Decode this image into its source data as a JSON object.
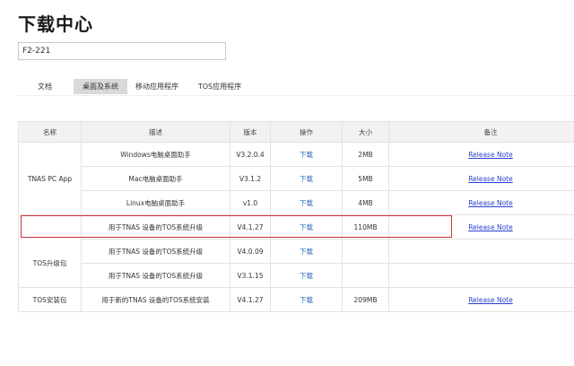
{
  "page": {
    "title": "下载中心"
  },
  "search": {
    "value": "F2-221"
  },
  "tabs": [
    {
      "label": "文档"
    },
    {
      "label": "桌面及系统"
    },
    {
      "label": "移动应用程序"
    },
    {
      "label": "TOS应用程序"
    }
  ],
  "active_tab": "桌面及系统",
  "table": {
    "headers": {
      "name": "名称",
      "desc": "描述",
      "version": "版本",
      "action": "操作",
      "size": "大小",
      "note": "备注"
    },
    "groups": {
      "tnas_pc_app": "TNAS PC App",
      "tos_upgrade": "TOS升级包",
      "tos_install": "TOS安装包"
    },
    "rows": [
      {
        "desc": "Windows电脑桌面助手",
        "version": "V3.2.0.4",
        "action": "下载",
        "size": "2MB",
        "note": "Release Note"
      },
      {
        "desc": "Mac电脑桌面助手",
        "version": "V3.1.2",
        "action": "下载",
        "size": "5MB",
        "note": "Release Note"
      },
      {
        "desc": "Linux电脑桌面助手",
        "version": "v1.0",
        "action": "下载",
        "size": "4MB",
        "note": "Release Note"
      },
      {
        "desc": "用于TNAS 设备的TOS系统升级",
        "version": "V4.1.27",
        "action": "下载",
        "size": "110MB",
        "note": "Release Note"
      },
      {
        "desc": "用于TNAS 设备的TOS系统升级",
        "version": "V4.0.09",
        "action": "下载",
        "size": "",
        "note": ""
      },
      {
        "desc": "用于TNAS 设备的TOS系统升级",
        "version": "V3.1.15",
        "action": "下载",
        "size": "",
        "note": ""
      },
      {
        "desc": "用于新的TNAS 设备的TOS系统安装",
        "version": "V4.1.27",
        "action": "下载",
        "size": "209MB",
        "note": "Release Note"
      }
    ]
  },
  "colors": {
    "highlight_border": "#c9323a",
    "link_blue": "#2f6fb5",
    "release_note_link": "#2a3fd1"
  }
}
